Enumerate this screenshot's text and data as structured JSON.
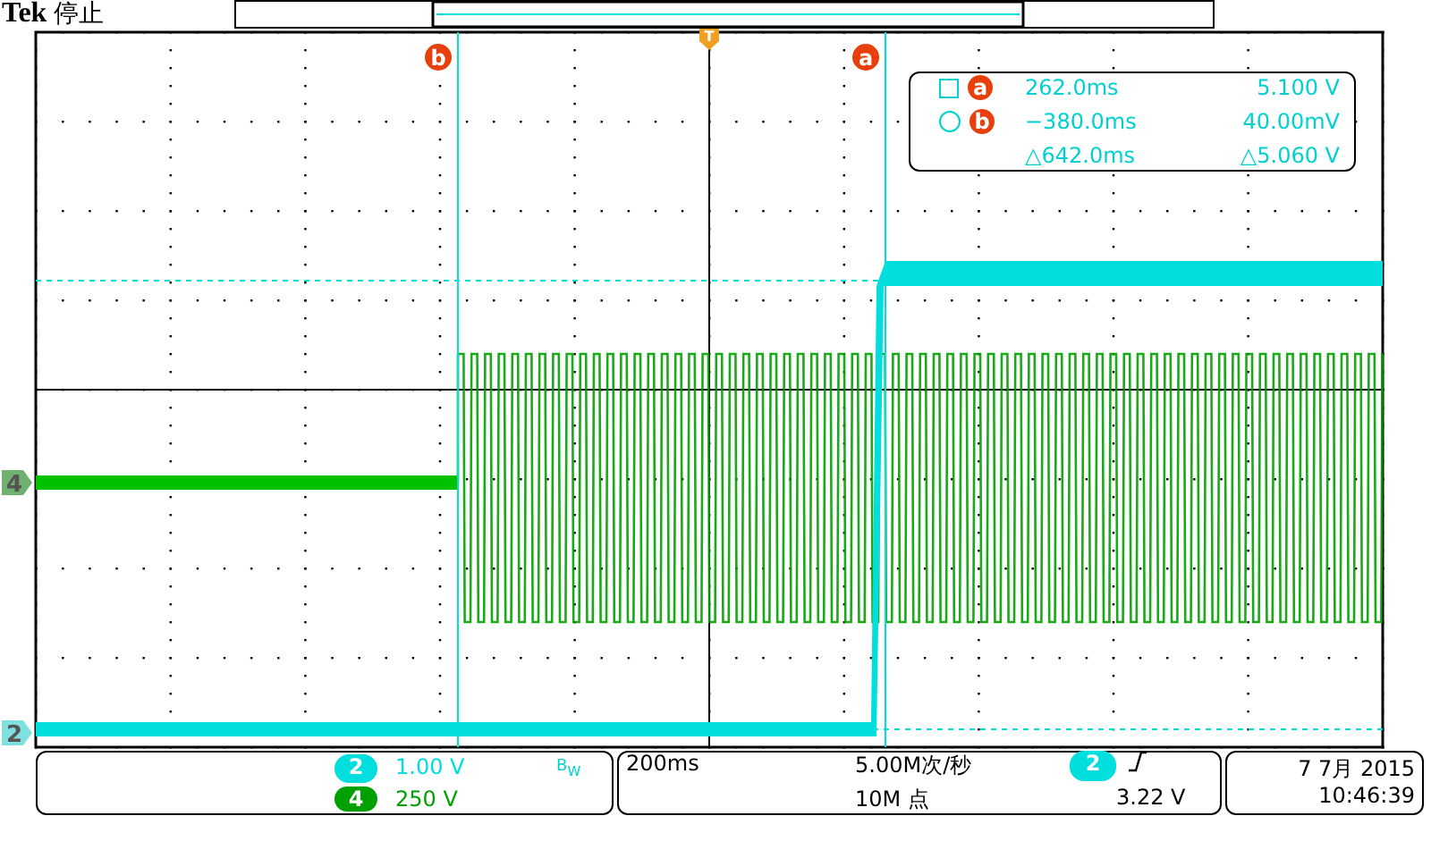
{
  "header": {
    "brand": "Tek",
    "status": "停止"
  },
  "trigger_marker": "T",
  "channel_markers": [
    {
      "number": "4"
    },
    {
      "number": "2"
    }
  ],
  "cursors": [
    {
      "label": "b"
    },
    {
      "label": "a"
    }
  ],
  "readout": [
    {
      "kind": "square",
      "cursor": "a",
      "time": "262.0ms",
      "value": "5.100 V"
    },
    {
      "kind": "circle",
      "cursor": "b",
      "time": "−380.0ms",
      "value": "40.00mV"
    },
    {
      "kind": "delta",
      "time": "△642.0ms",
      "value": "△5.060 V"
    }
  ],
  "channels": [
    {
      "number": "2",
      "color": "#00dede",
      "scale": "1.00 V",
      "bandwidth_limit": "B$_{W}$"
    },
    {
      "number": "4",
      "color": "#00a000",
      "scale": "250 V"
    }
  ],
  "acquisition": {
    "timebase": "200ms",
    "sample_rate": "5.00M次/秒",
    "record_length": "10M 点"
  },
  "trigger": {
    "source": "2",
    "slope": {
      "kind": "rising"
    },
    "level": "3.22 V"
  },
  "clock": {
    "date": "7 7月 2015",
    "time": "10:46:39"
  }
}
